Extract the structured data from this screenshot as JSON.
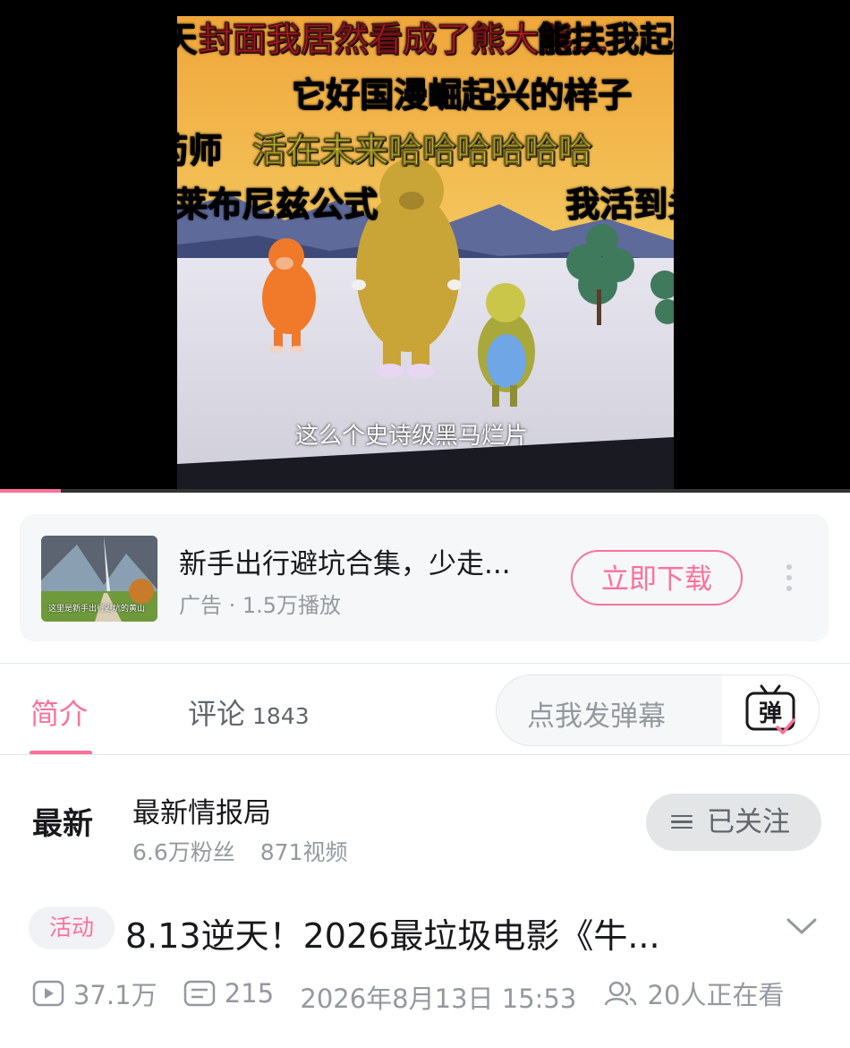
{
  "player": {
    "danmaku": [
      {
        "text": "美人鱼的夏天",
        "color": "#ffffff"
      },
      {
        "text": "封面我居然看成了熊大熊二",
        "color": "#e0232d"
      },
      {
        "text": "能扶我起来吗？",
        "color": "#ffffff"
      },
      {
        "text": "它好国漫崛起兴的样子",
        "color": "#ffffff"
      },
      {
        "text": "南刊的药师",
        "color": "#ffffff"
      },
      {
        "text": "活在未来哈哈哈哈哈哈",
        "color": "#f7e63a"
      },
      {
        "text": "牛顿莱布尼兹公式",
        "color": "#ffffff"
      },
      {
        "text": "我活到头了？这是",
        "color": "#ffffff"
      }
    ],
    "subtitle": "这么个史诗级黑马烂片",
    "progress": 0.072,
    "accent_color": "#fb7299"
  },
  "ad": {
    "thumb_text": "这里是新手出行避坑的黄山",
    "title": "新手出行避坑合集，少走...",
    "meta": "广告 · 1.5万播放",
    "button_label": "立即下载",
    "more_icon": "more-vertical-icon"
  },
  "tabs": {
    "intro_label": "简介",
    "comments_label": "评论",
    "comments_count": "1843"
  },
  "danmaku_input": {
    "placeholder": "点我发弹幕",
    "toggle_icon": "danmaku-toggle-icon",
    "toggle_glyph": "弹"
  },
  "uploader": {
    "avatar_text": "最新",
    "name": "最新情报局",
    "followers": "6.6万粉丝",
    "videos": "871视频",
    "follow_label": "已关注"
  },
  "video": {
    "badge": "活动",
    "title": "8.13逆天！2026最垃圾电影《牛...",
    "views": "37.1万",
    "danmaku_count": "215",
    "date": "2026年8月13日 15:53",
    "watching": "20人正在看"
  }
}
